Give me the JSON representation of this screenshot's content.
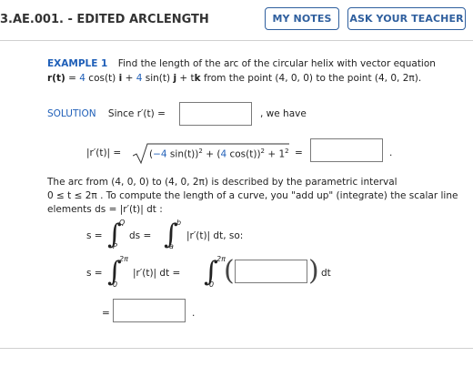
{
  "header": {
    "title": "3.AE.001. - EDITED ARCLENGTH",
    "my_notes": "MY NOTES",
    "ask_teacher": "ASK YOUR TEACHER"
  },
  "example": {
    "label": "EXAMPLE 1",
    "text_line1": "Find the length of the arc of the circular helix with vector equation",
    "text_line2_html_parts": [
      "r(t)",
      " = ",
      "4",
      " cos(t) ",
      "i",
      " + ",
      "4",
      " sin(t) ",
      "j",
      " + t",
      "k",
      " from the point  (4, 0, 0)  to the point  (4, 0, 2π)."
    ]
  },
  "solution": {
    "label": "SOLUTION",
    "since_text": "Since  r′(t) =",
    "we_have": ", we have",
    "magnitude_lhs": "|r′(t)| =",
    "radicand_prefix": "(",
    "radicand_a": "−4",
    "radicand_b": " sin(t))",
    "radicand_c": "2",
    "radicand_d": " + (",
    "radicand_e": "4",
    "radicand_f": " cos(t))",
    "radicand_g": "2",
    "radicand_h": " + 1",
    "radicand_i": "2",
    "equals": "=",
    "period": "."
  },
  "paragraph": {
    "line1": "The arc from  (4, 0, 0)  to  (4, 0, 2π)  is described by the parametric interval",
    "line2": "0 ≤ t ≤ 2π . To compute the length of a curve, you \"add up\" (integrate) the scalar line",
    "line3": "elements  ds = |r′(t)| dt :"
  },
  "formula1": {
    "s_eq": "s =",
    "upper_q": "Q",
    "lower_p": "P",
    "ds": "ds =",
    "upper_b": "b",
    "lower_a": "a",
    "integrand": "|r′(t)| dt, so:"
  },
  "formula2": {
    "s_eq": "s =",
    "upper": "2π",
    "lower": "0",
    "integrand": "|r′(t)| dt =",
    "upper2": "2π",
    "lower2": "0",
    "dt": "dt"
  },
  "final": {
    "equals": "=",
    "period": "."
  },
  "colors": {
    "accent": "#2f5f9e",
    "blue_text": "#1f5fb8"
  }
}
